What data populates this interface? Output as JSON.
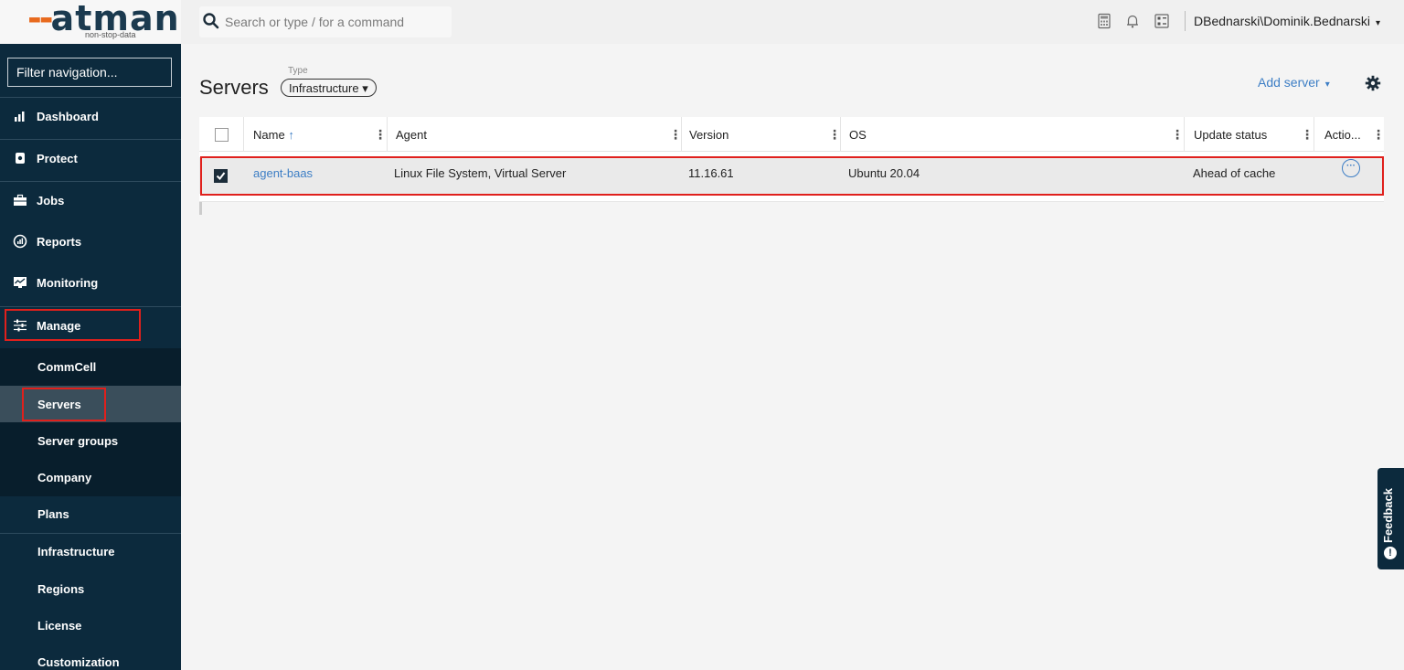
{
  "brand": {
    "name": "atman",
    "dashes": "--",
    "tagline": "non-stop-data",
    "accent": "#e86a1e",
    "primary": "#1b3a4f"
  },
  "search": {
    "placeholder": "Search or type / for a command"
  },
  "header": {
    "icons": [
      "calculator-icon",
      "bell-icon",
      "switch-icon"
    ],
    "user": "DBednarski\\Dominik.Bednarski",
    "user_caret": "▾"
  },
  "sidebar": {
    "filter_placeholder": "Filter navigation...",
    "items": [
      {
        "label": "Dashboard",
        "icon": "dashboard-icon"
      },
      {
        "label": "Protect",
        "icon": "shield-icon"
      },
      {
        "label": "Jobs",
        "icon": "briefcase-icon"
      },
      {
        "label": "Reports",
        "icon": "reports-icon"
      },
      {
        "label": "Monitoring",
        "icon": "monitor-icon"
      },
      {
        "label": "Manage",
        "icon": "sliders-icon"
      }
    ],
    "manage_sub": [
      "CommCell",
      "Servers",
      "Server groups",
      "Company",
      "Plans"
    ],
    "more_sub": [
      "Infrastructure",
      "Regions",
      "License",
      "Customization"
    ],
    "active_item": "Servers",
    "bg_color": "#0c2a3d"
  },
  "page": {
    "title": "Servers",
    "type_label": "Type",
    "type_value": "Infrastructure",
    "type_caret": "▾",
    "add_server": "Add server",
    "add_caret": "▾"
  },
  "table": {
    "columns": [
      "Name",
      "Agent",
      "Version",
      "OS",
      "Update status",
      "Actio..."
    ],
    "sort_indicator": "↑",
    "rows": [
      {
        "checked": true,
        "name": "agent-baas",
        "agent": "Linux File System, Virtual Server",
        "version": "11.16.61",
        "os": "Ubuntu 20.04",
        "update_status": "Ahead of cache",
        "action": "···"
      }
    ]
  },
  "feedback": {
    "label": "Feedback",
    "icon": "!"
  },
  "highlight_color": "#e0201c",
  "link_color": "#3d7ec5"
}
